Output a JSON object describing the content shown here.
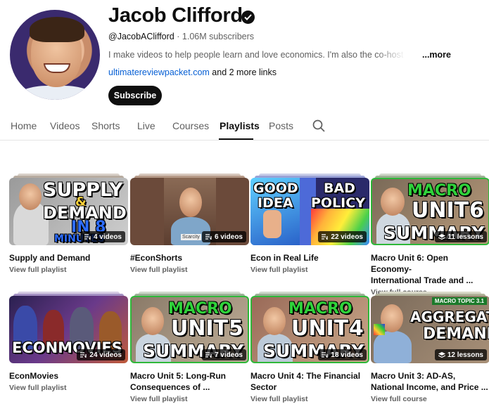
{
  "channel": {
    "name": "Jacob Clifford",
    "handle": "@JacobAClifford",
    "separator": "·",
    "subscribers": "1.06M subscribers",
    "description": "I make videos to help people learn and love economics. I'm also the co-host of Crash Course",
    "more_label": "...more",
    "link_text": "ultimatereviewpacket.com",
    "more_links": "and 2 more links",
    "subscribe_label": "Subscribe"
  },
  "tabs": [
    {
      "label": "Home"
    },
    {
      "label": "Videos"
    },
    {
      "label": "Shorts"
    },
    {
      "label": "Live"
    },
    {
      "label": "Courses"
    },
    {
      "label": "Playlists",
      "active": true
    },
    {
      "label": "Posts"
    }
  ],
  "playlists": [
    {
      "title_line1": "Supply and Demand",
      "title_line2": "",
      "badge": "4 videos",
      "link": "View full playlist",
      "thumb_text": [
        "SUPPLY",
        "&",
        "DEMAND",
        "IN 8",
        "MINUTES"
      ]
    },
    {
      "title_line1": "#EconShorts",
      "title_line2": "",
      "badge": "6 videos",
      "link": "View full playlist",
      "thumb_text": [
        "Scarcity"
      ]
    },
    {
      "title_line1": "Econ in Real Life",
      "title_line2": "",
      "badge": "22 videos",
      "link": "View full playlist",
      "thumb_text": [
        "GOOD",
        "IDEA",
        "BAD",
        "POLICY"
      ]
    },
    {
      "title_line1": "Macro Unit 6: Open Economy-",
      "title_line2": "International Trade and ...",
      "badge": "11 lessons",
      "link": "View full course",
      "thumb_text": [
        "MACRO",
        "UNIT",
        "6",
        "SUMMARY"
      ]
    },
    {
      "title_line1": "EconMovies",
      "title_line2": "",
      "badge": "24 videos",
      "link": "View full playlist",
      "thumb_text": [
        "ECONMOVIES"
      ]
    },
    {
      "title_line1": "Macro Unit 5: Long-Run",
      "title_line2": "Consequences of ...",
      "badge": "7 videos",
      "link": "View full playlist",
      "thumb_text": [
        "MACRO",
        "UNIT",
        "5",
        "SUMMARY"
      ]
    },
    {
      "title_line1": "Macro Unit 4: The Financial",
      "title_line2": "Sector",
      "badge": "18 videos",
      "link": "View full playlist",
      "thumb_text": [
        "MACRO",
        "UNIT",
        "4",
        "SUMMARY"
      ]
    },
    {
      "title_line1": "Macro Unit 3: AD-AS,",
      "title_line2": "National Income, and Price ...",
      "badge": "12 lessons",
      "link": "View full course",
      "thumb_text": [
        "MACRO TOPIC 3.1",
        "AGGREGATE",
        "DEMAND"
      ]
    }
  ],
  "icons": {
    "verified": "verified-check-icon",
    "search": "search-icon",
    "playlist": "playlist-icon",
    "course": "course-stack-icon"
  },
  "colors": {
    "link": "#065fd4",
    "macro_green": "#2fb83a",
    "subscribe_bg": "#0f0f0f"
  }
}
